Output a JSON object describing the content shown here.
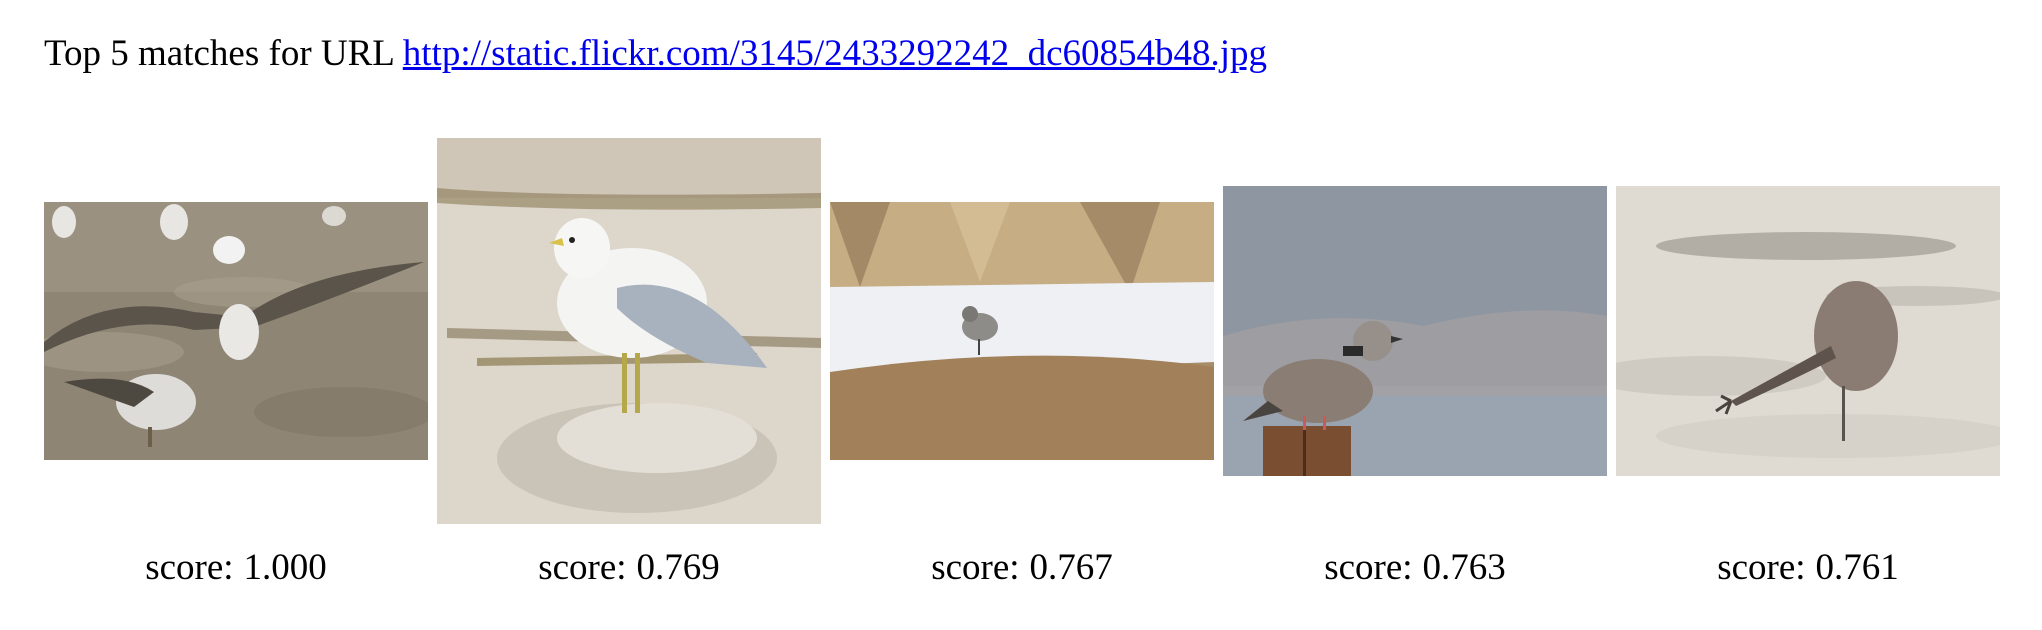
{
  "header": {
    "prefix": "Top 5 matches for URL",
    "url_text": "http://static.flickr.com/3145/2433292242_dc60854b48.jpg"
  },
  "results": [
    {
      "score_label": "score:",
      "score_value": "1.000",
      "image": "bird-flock-image"
    },
    {
      "score_label": "score:",
      "score_value": "0.769",
      "image": "seagull-image"
    },
    {
      "score_label": "score:",
      "score_value": "0.767",
      "image": "mockingbird-image"
    },
    {
      "score_label": "score:",
      "score_value": "0.763",
      "image": "dove-image"
    },
    {
      "score_label": "score:",
      "score_value": "0.761",
      "image": "shorebird-image"
    }
  ],
  "colors": {
    "link": "#0000ee",
    "text": "#000000",
    "background": "#ffffff"
  }
}
